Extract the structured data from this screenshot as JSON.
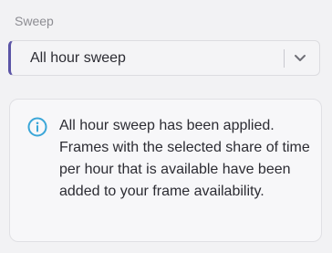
{
  "sweep": {
    "label": "Sweep",
    "selected_value": "All hour sweep",
    "chevron_icon": "chevron-down-icon",
    "accent_color": "#5b54a6"
  },
  "info": {
    "icon": "info-icon",
    "icon_color": "#3aa6d8",
    "message": "All hour sweep has been applied. Frames with the selected share of time per hour that is available have been added to your frame availability."
  }
}
